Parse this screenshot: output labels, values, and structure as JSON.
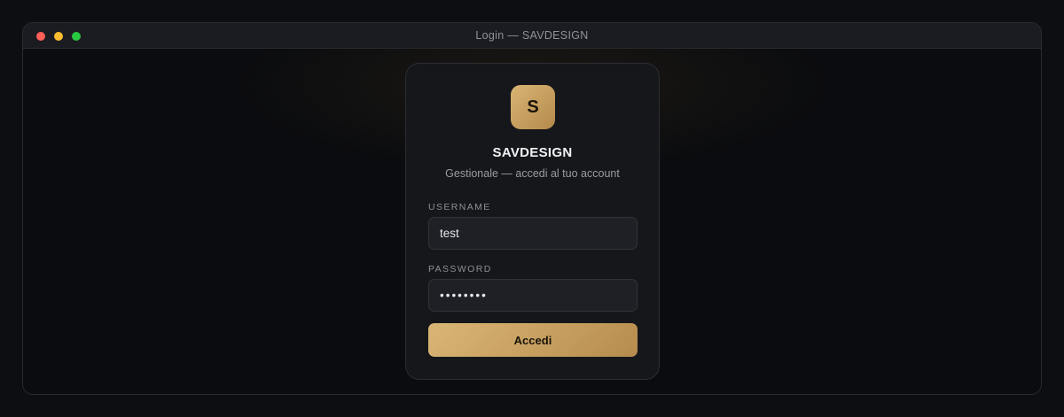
{
  "window": {
    "title": "Login — SAVDESIGN"
  },
  "login": {
    "logo_letter": "S",
    "brand": "SAVDESIGN",
    "subtitle": "Gestionale — accedi al tuo account",
    "username_label": "USERNAME",
    "username_value": "test",
    "password_label": "PASSWORD",
    "password_value": "password",
    "submit_label": "Accedi"
  },
  "icons": {
    "close": "close-dot-icon",
    "minimize": "minimize-dot-icon",
    "maximize": "maximize-dot-icon"
  },
  "colors": {
    "accent": "#c9a363",
    "card": "#16171b",
    "background": "#0b0c0f"
  }
}
